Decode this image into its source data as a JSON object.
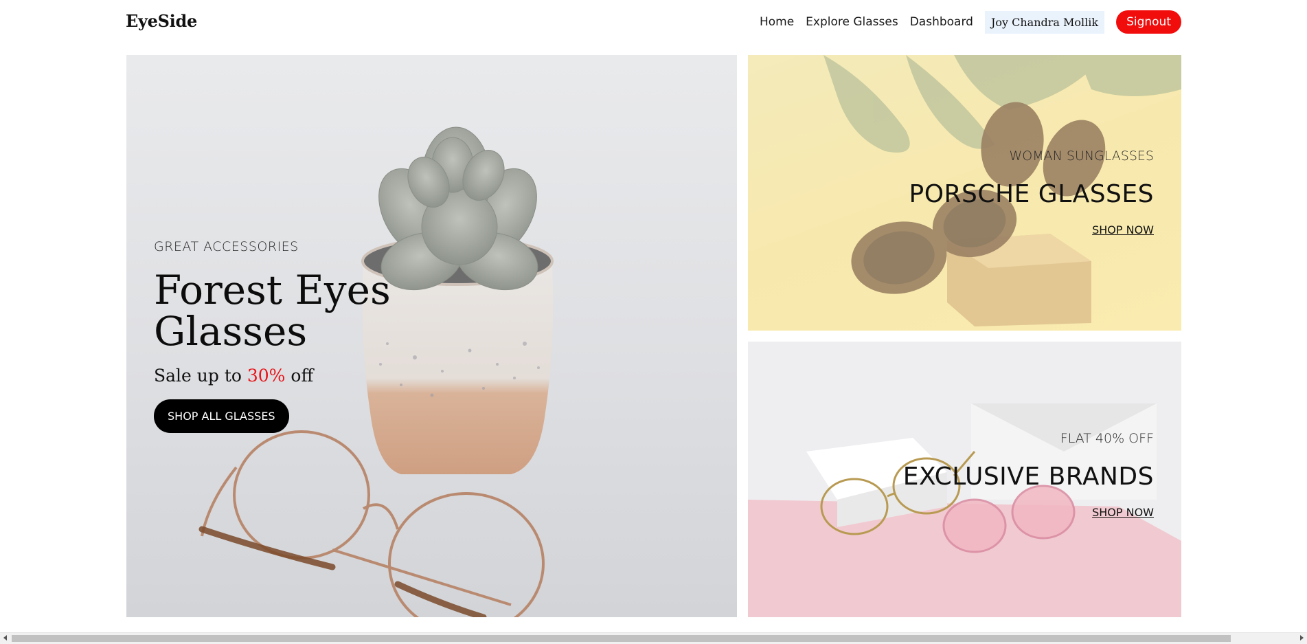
{
  "header": {
    "logo": "EyeSide",
    "nav": [
      "Home",
      "Explore Glasses",
      "Dashboard"
    ],
    "user_name": "Joy Chandra Mollik",
    "signout_label": "Signout"
  },
  "hero": {
    "eyebrow": "GREAT ACCESSORIES",
    "title": "Forest Eyes Glasses",
    "sale_prefix": "Sale up to",
    "sale_percent": "30%",
    "sale_suffix": "off",
    "cta_label": "SHOP ALL GLASSES"
  },
  "promo_top": {
    "eyebrow": "WOMAN SUNGLASSES",
    "title": "PORSCHE GLASSES",
    "link": "SHOP NOW"
  },
  "promo_bottom": {
    "eyebrow": "FLAT 40% OFF",
    "title": "EXCLUSIVE BRANDS",
    "link": "SHOP NOW"
  },
  "colors": {
    "accent_red": "#f20d0d",
    "cta_black": "#000000",
    "user_chip_bg": "#eaf2fb"
  }
}
